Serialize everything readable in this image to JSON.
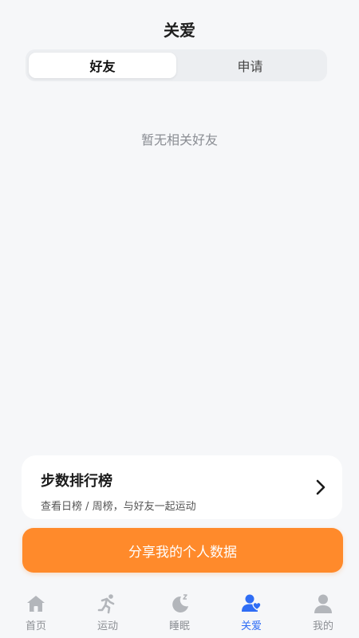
{
  "header": {
    "title": "关爱"
  },
  "tabs": [
    {
      "label": "好友",
      "active": true
    },
    {
      "label": "申请",
      "active": false
    }
  ],
  "empty_state": {
    "text": "暂无相关好友"
  },
  "ranking_card": {
    "title": "步数排行榜",
    "subtitle": "查看日榜 / 周榜，与好友一起运动",
    "arrow_icon": "chevron-right-icon"
  },
  "share_button": {
    "label": "分享我的个人数据"
  },
  "bottom_nav": {
    "items": [
      {
        "label": "首页",
        "icon": "home-icon",
        "active": false
      },
      {
        "label": "运动",
        "icon": "running-icon",
        "active": false
      },
      {
        "label": "睡眠",
        "icon": "moon-sleep-icon",
        "active": false
      },
      {
        "label": "关爱",
        "icon": "friends-icon",
        "active": true
      },
      {
        "label": "我的",
        "icon": "profile-icon",
        "active": false
      }
    ]
  },
  "colors": {
    "accent_orange": "#ff8a2b",
    "nav_active": "#2f6df5",
    "nav_inactive": "#8c8f94",
    "background": "#f6f7f9"
  }
}
